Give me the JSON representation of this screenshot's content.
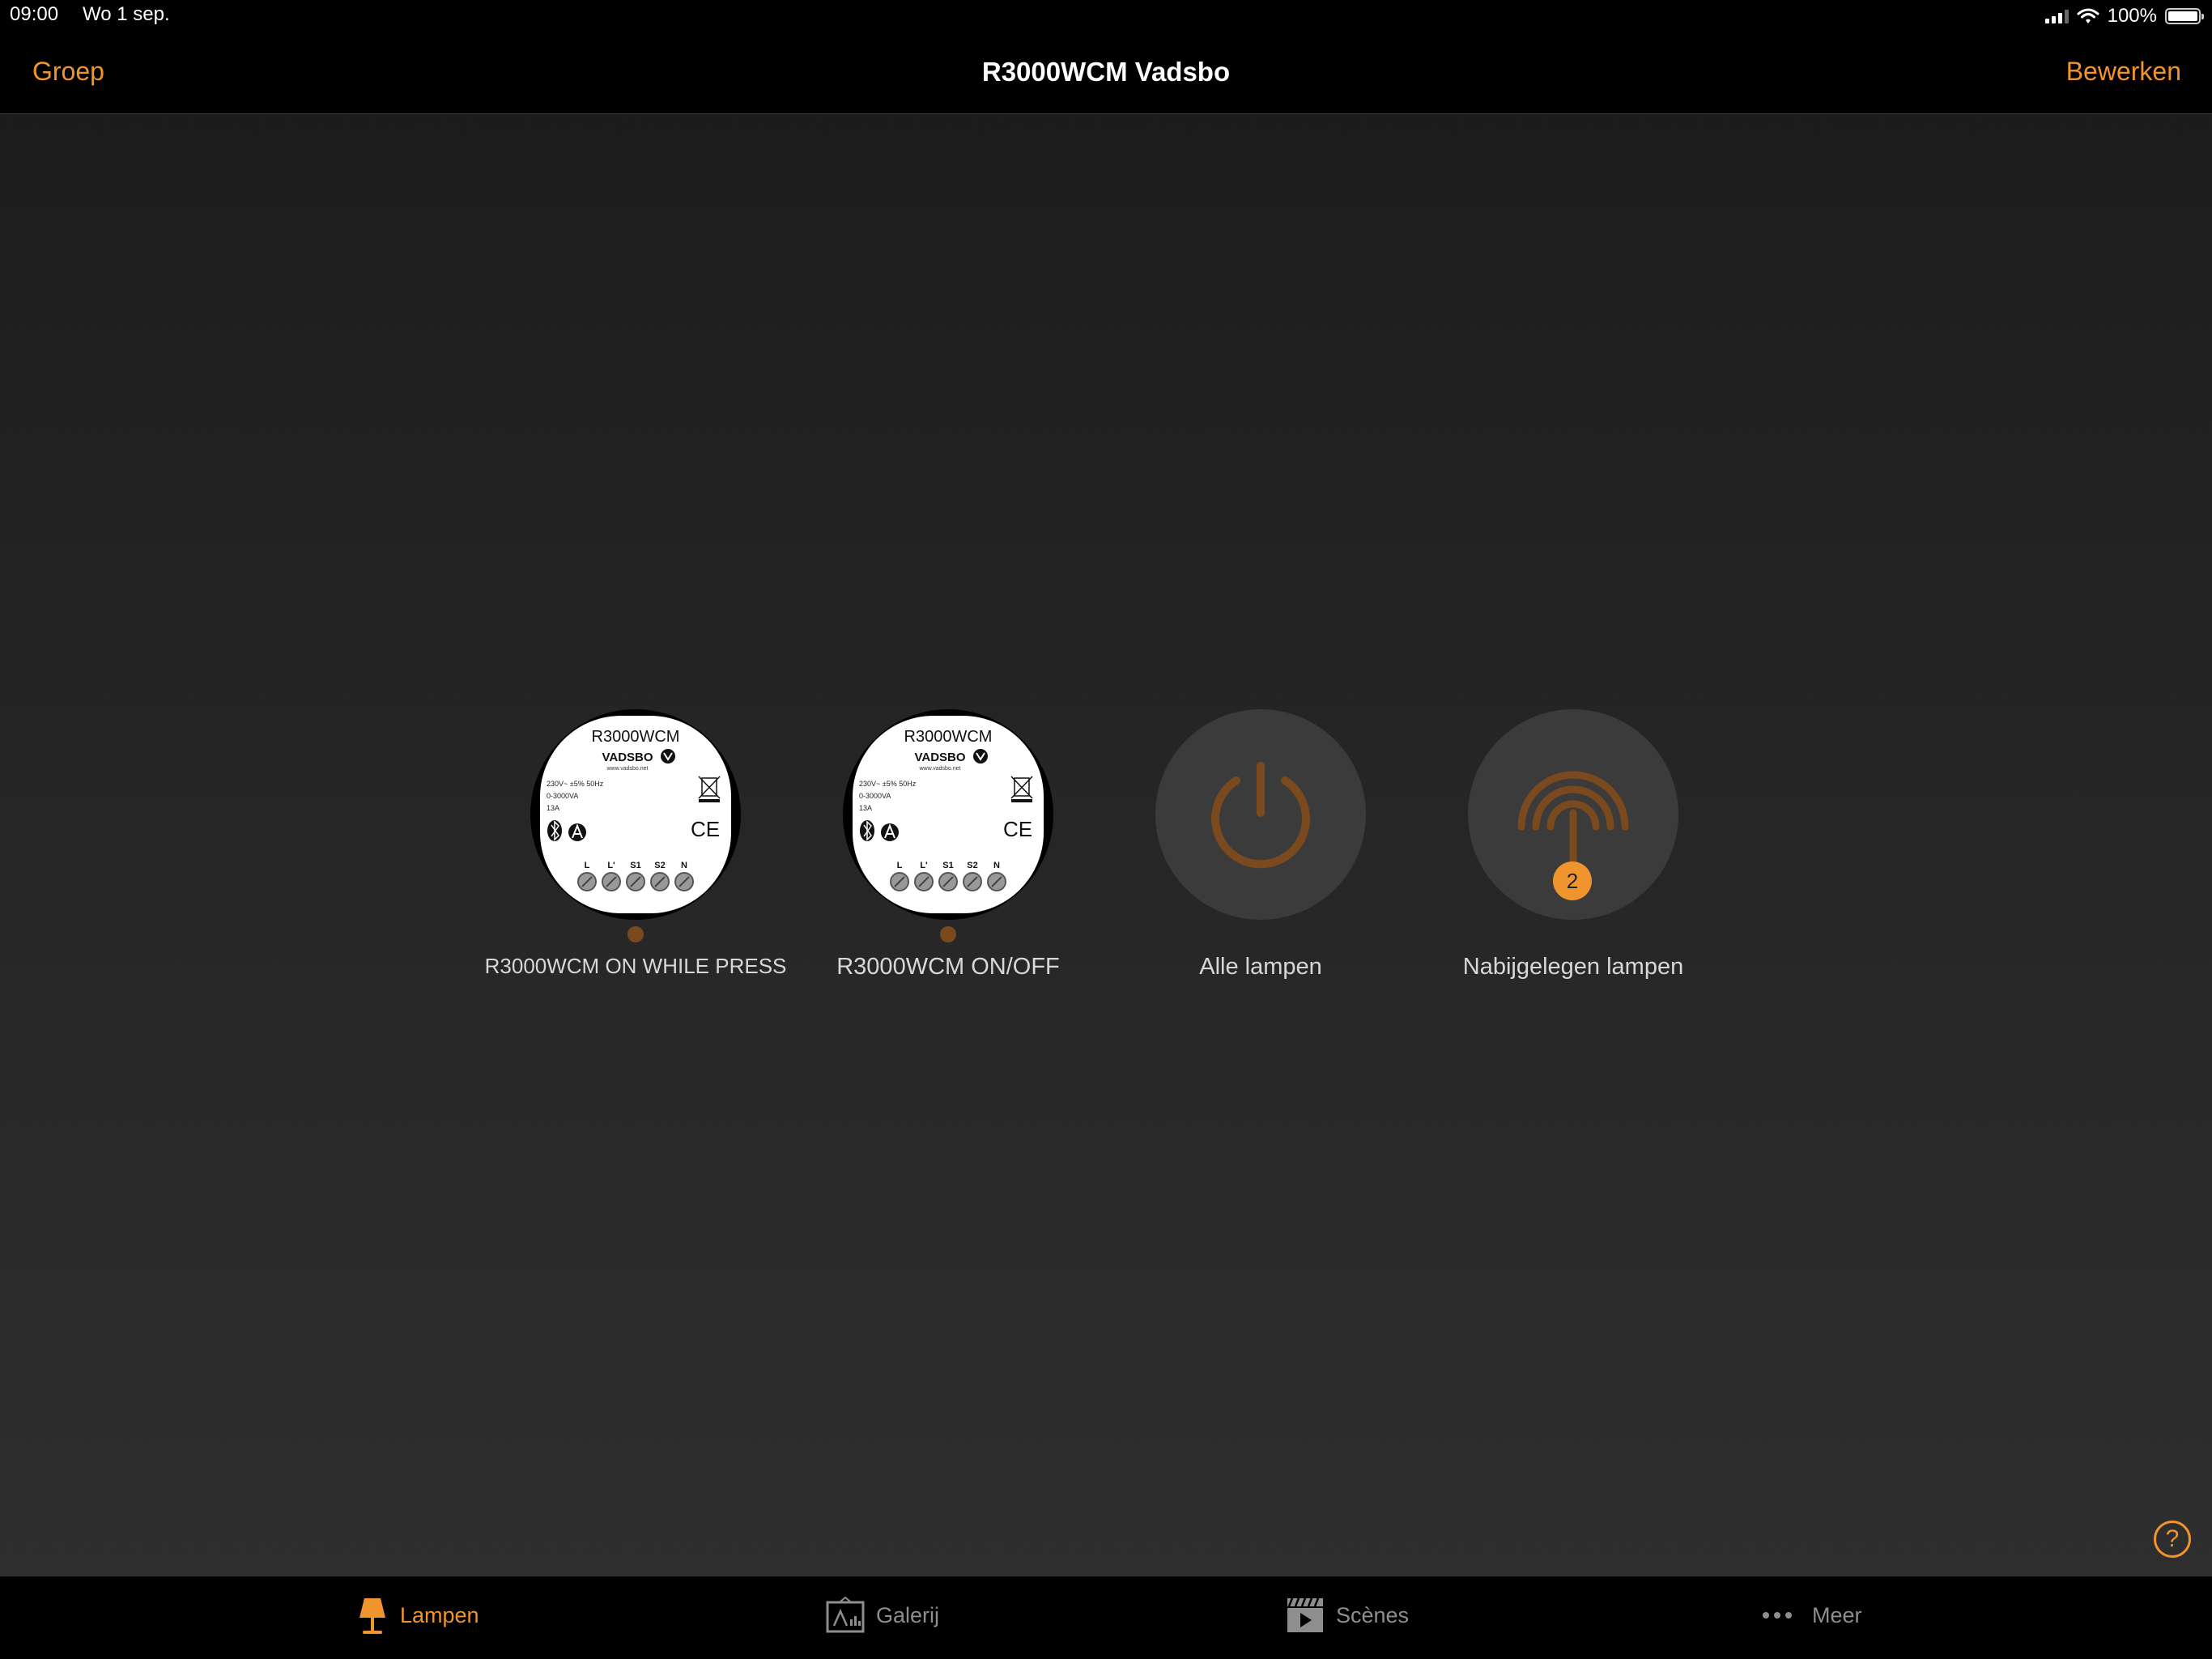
{
  "status_bar": {
    "time": "09:00",
    "date": "Wo 1 sep.",
    "battery": "100%",
    "battery_level": 1.0
  },
  "nav": {
    "back_label": "Groep",
    "title": "R3000WCM Vadsbo",
    "edit_label": "Bewerken"
  },
  "colors": {
    "accent": "#f0952e",
    "tile_bg": "#3b3b3b",
    "dim_orange": "#7a4a1e"
  },
  "devices": [
    {
      "label": "R3000WCM ON WHILE PRESS"
    },
    {
      "label": "R3000WCM ON/OFF"
    }
  ],
  "device_label": {
    "model": "R3000WCM",
    "brand": "VADSBO",
    "url": "www.vadsbo.net",
    "spec1": "230V~ ±5% 50Hz",
    "spec2": "0-3000VA",
    "spec3": "13A",
    "ce": "CE",
    "terminals": [
      "L",
      "L'",
      "S1",
      "S2",
      "N"
    ]
  },
  "actions": {
    "all_lamps": {
      "label": "Alle lampen",
      "icon": "power-icon"
    },
    "nearby_lamps": {
      "label": "Nabijgelegen lampen",
      "icon": "nearby-signal-icon",
      "badge": "2"
    }
  },
  "help": {
    "symbol": "?"
  },
  "tabs": [
    {
      "label": "Lampen",
      "icon": "lamp-icon",
      "active": true
    },
    {
      "label": "Galerij",
      "icon": "gallery-icon",
      "active": false
    },
    {
      "label": "Scènes",
      "icon": "clapperboard-icon",
      "active": false
    },
    {
      "label": "Meer",
      "icon": "more-dots-icon",
      "active": false
    }
  ]
}
